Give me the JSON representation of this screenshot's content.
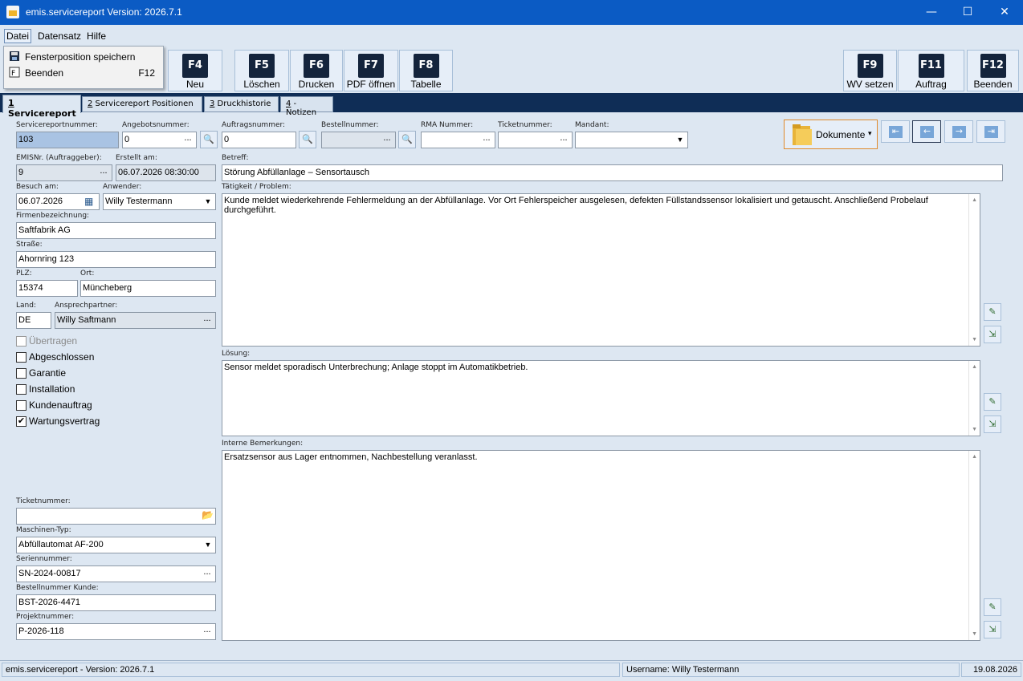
{
  "window": {
    "title": "emis.servicereport Version: 2026.7.1",
    "minimize": "—",
    "maximize": "☐",
    "close": "✕"
  },
  "menu": {
    "items": [
      "Datei",
      "Datensatz",
      "Hilfe"
    ]
  },
  "file_menu": [
    {
      "label": "Fensterposition speichern",
      "shortcut": "",
      "icon": "save-icon"
    },
    {
      "label": "Beenden",
      "shortcut": "F12",
      "icon": "exit-icon"
    }
  ],
  "toolbar": {
    "buttons": [
      {
        "key": "F4",
        "label": "Neu"
      },
      {
        "key": "F5",
        "label": "Löschen"
      },
      {
        "key": "F6",
        "label": "Drucken"
      },
      {
        "key": "F7",
        "label": "PDF öffnen"
      },
      {
        "key": "F8",
        "label": "Tabelle"
      },
      {
        "key": "F9",
        "label": "WV setzen"
      },
      {
        "key": "F11",
        "label": "Auftrag"
      },
      {
        "key": "F12",
        "label": "Beenden"
      }
    ]
  },
  "tabs": [
    {
      "num": "1",
      "label": " Servicereport"
    },
    {
      "num": "2",
      "label": " Servicereport Positionen"
    },
    {
      "num": "3",
      "label": " Druckhistorie"
    },
    {
      "num": "4",
      "label": " - Notizen"
    }
  ],
  "form": {
    "servicereportnummer": {
      "label": "Servicereportnummer:",
      "value": "103"
    },
    "angebotsnummer": {
      "label": "Angebotsnummer:",
      "value": "0"
    },
    "auftragsnummer": {
      "label": "Auftragsnummer:",
      "value": "0"
    },
    "bestellnummer": {
      "label": "Bestellnummer:",
      "value": ""
    },
    "rma": {
      "label": "RMA Nummer:",
      "value": ""
    },
    "ticketnummer_top": {
      "label": "Ticketnummer:",
      "value": ""
    },
    "mandant": {
      "label": "Mandant:",
      "value": ""
    },
    "emisnr": {
      "label": "EMISNr. (Auftraggeber):",
      "value": "9"
    },
    "erstellt": {
      "label": "Erstellt am:",
      "value": "06.07.2026 08:30:00"
    },
    "betreff": {
      "label": "Betreff:",
      "value": "Störung Abfüllanlage – Sensortausch"
    },
    "besuch": {
      "label": "Besuch am:",
      "value": "06.07.2026"
    },
    "anwender": {
      "label": "Anwender:",
      "value": "Willy Testermann"
    },
    "firma": {
      "label": "Firmenbezeichnung:",
      "value": "Saftfabrik AG"
    },
    "strasse": {
      "label": "Straße:",
      "value": "Ahornring 123"
    },
    "plz": {
      "label": "PLZ:",
      "value": "15374"
    },
    "ort": {
      "label": "Ort:",
      "value": "Müncheberg"
    },
    "land": {
      "label": "Land:",
      "value": "DE"
    },
    "ansprechpartner": {
      "label": "Ansprechpartner:",
      "value": "Willy Saftmann"
    },
    "taetigkeit": {
      "label": "Tätigkeit / Problem:",
      "value": "Kunde meldet wiederkehrende Fehlermeldung an der Abfüllanlage. Vor Ort Fehlerspeicher ausgelesen, defekten Füllstandssensor lokalisiert und getauscht. Anschließend Probelauf durchgeführt."
    },
    "loesung": {
      "label": "Lösung:",
      "value": "Sensor meldet sporadisch Unterbrechung; Anlage stoppt im Automatikbetrieb."
    },
    "bemerkungen": {
      "label": "Interne Bemerkungen:",
      "value": "Ersatzsensor aus Lager entnommen, Nachbestellung veranlasst."
    },
    "ticketnummer": {
      "label": "Ticketnummer:",
      "value": ""
    },
    "maschinentyp": {
      "label": "Maschinen-Typ:",
      "value": "Abfüllautomat AF-200"
    },
    "seriennummer": {
      "label": "Seriennummer:",
      "value": "SN-2024-00817"
    },
    "bestellnr_kunde": {
      "label": "Bestellnummer Kunde:",
      "value": "BST-2026-4471"
    },
    "projektnummer": {
      "label": "Projektnummer:",
      "value": "P-2026-118"
    }
  },
  "checkboxes": [
    {
      "label": "Übertragen",
      "checked": false,
      "disabled": true
    },
    {
      "label": "Abgeschlossen",
      "checked": false,
      "disabled": false
    },
    {
      "label": "Garantie",
      "checked": false,
      "disabled": false
    },
    {
      "label": "Installation",
      "checked": false,
      "disabled": false
    },
    {
      "label": "Kundenauftrag",
      "checked": false,
      "disabled": false
    },
    {
      "label": "Wartungsvertrag",
      "checked": true,
      "disabled": false
    }
  ],
  "dokumente": {
    "label": "Dokumente",
    "caret": "▾"
  },
  "nav": {
    "first": "⇤",
    "prev": "←",
    "next": "→",
    "last": "⇥"
  },
  "glyphs": {
    "dots": "...",
    "arrow": "▼",
    "check": "✔",
    "search": "🔍",
    "calendar": "▦",
    "folder": "📂",
    "edit": "✎",
    "export": "⇲",
    "up": "▲",
    "down": "▼"
  },
  "status": {
    "app": "emis.servicereport - Version: 2026.7.1",
    "user": "Username: Willy Testermann",
    "date": "19.08.2026"
  },
  "colors": {
    "titlebar": "#0b5bc4",
    "tabstrip": "#0f2d56",
    "background": "#dde7f2",
    "key_badge": "#14243c"
  }
}
